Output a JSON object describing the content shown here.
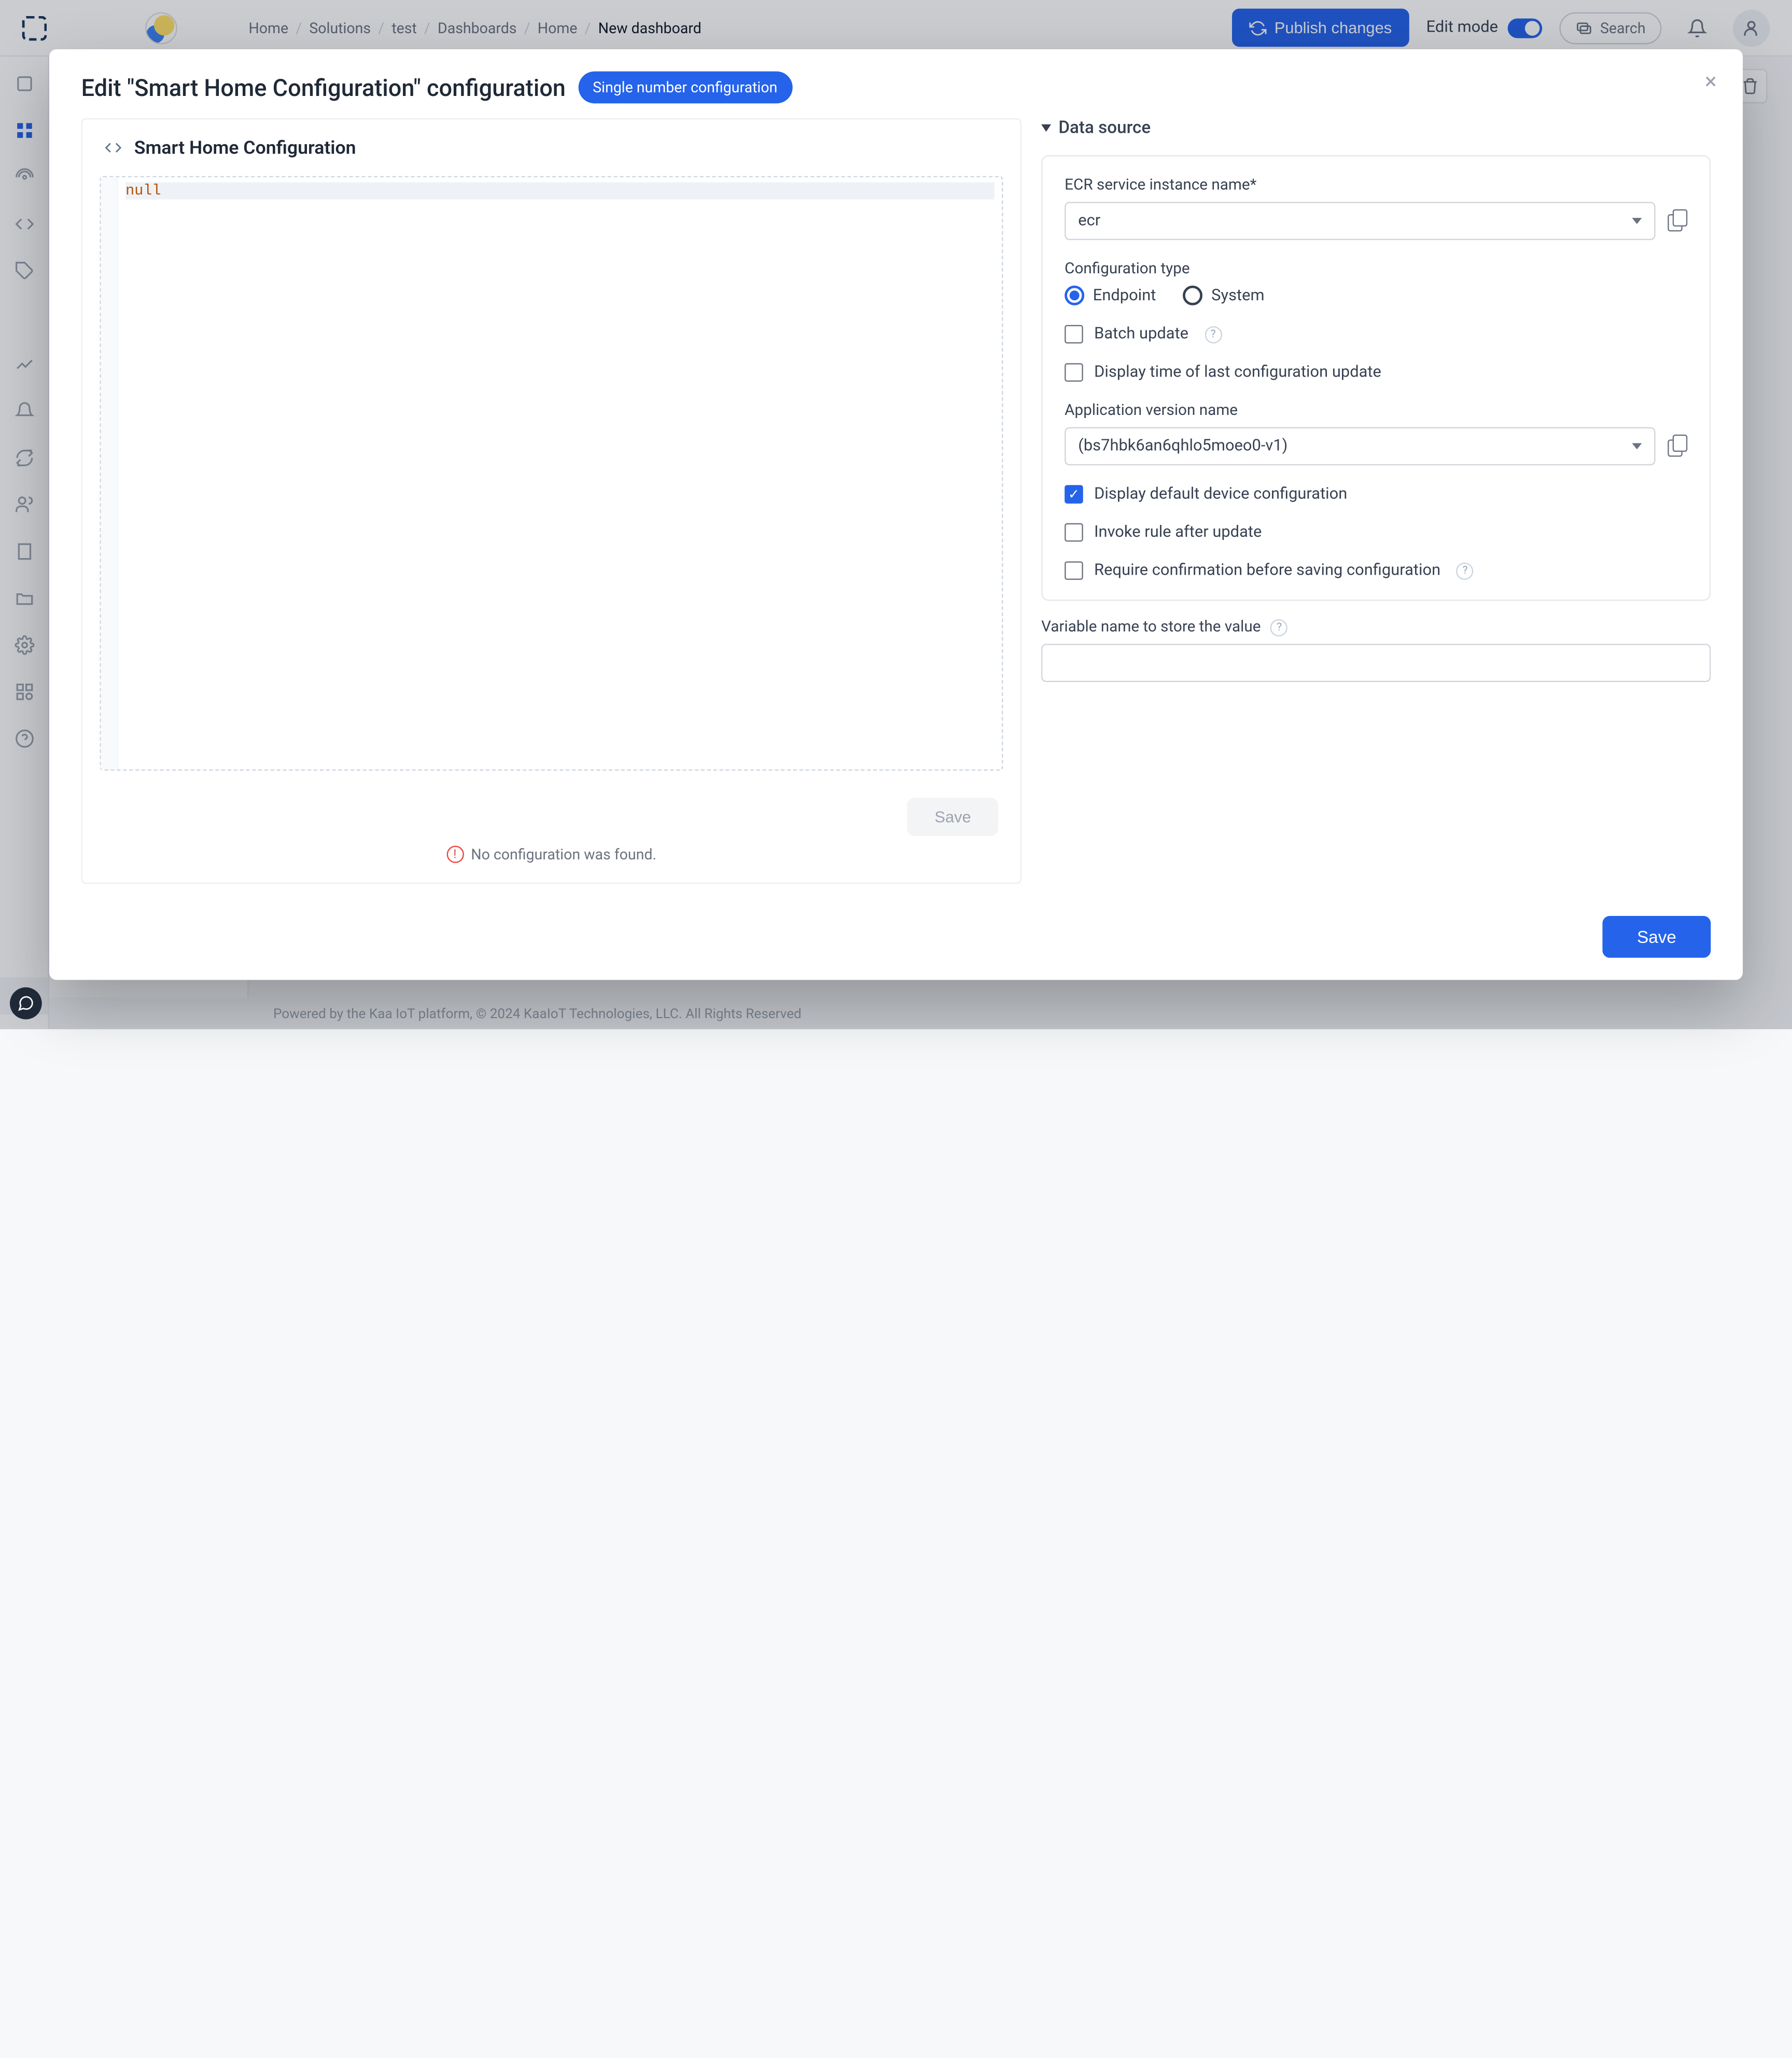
{
  "breadcrumbs": [
    "Home",
    "Solutions",
    "test",
    "Dashboards",
    "Home",
    "New dashboard"
  ],
  "topbar": {
    "publish": "Publish changes",
    "editMode": "Edit mode",
    "search": "Search"
  },
  "modal": {
    "title": "Edit \"Smart Home Configuration\" configuration",
    "badge": "Single number configuration",
    "panelTitle": "Smart Home Configuration",
    "codeValue": "null",
    "leftSave": "Save",
    "errorMsg": "No configuration was found.",
    "save": "Save"
  },
  "dataSource": {
    "header": "Data source",
    "ecrLabel": "ECR service instance name",
    "ecrValue": "ecr",
    "configTypeLabel": "Configuration type",
    "radioEndpoint": "Endpoint",
    "radioSystem": "System",
    "batchUpdate": "Batch update",
    "displayTime": "Display time of last configuration update",
    "appVersionLabel": "Application version name",
    "appVersionValue": "(bs7hbk6an6qhlo5moeo0-v1)",
    "displayDefault": "Display default device configuration",
    "invokeRule": "Invoke rule after update",
    "requireConfirm": "Require confirmation before saving configuration",
    "variableLabel": "Variable name to store the value",
    "variableValue": ""
  },
  "footer": "Powered by the Kaa IoT platform, © 2024 KaaIoT Technologies, LLC. All Rights Reserved"
}
